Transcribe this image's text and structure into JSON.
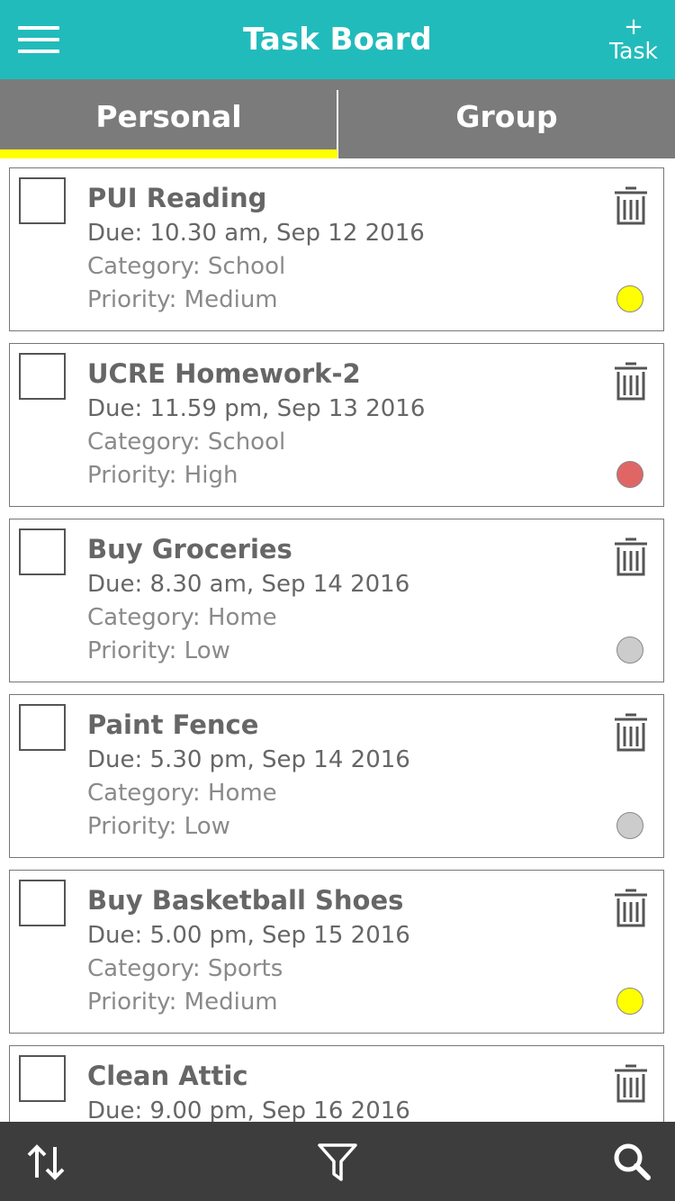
{
  "header": {
    "title": "Task Board",
    "add_plus": "+",
    "add_label": "Task",
    "color": "#22bbbb"
  },
  "tabs": [
    {
      "label": "Personal",
      "active": true
    },
    {
      "label": "Group",
      "active": false
    }
  ],
  "tab_indicator_color": "#ffff00",
  "tasks": [
    {
      "title": "PUI Reading",
      "due": "Due: 10.30 am, Sep 12 2016",
      "category": "Category: School",
      "priority": "Priority: Medium",
      "priority_color": "#ffff00"
    },
    {
      "title": "UCRE Homework-2",
      "due": "Due: 11.59 pm, Sep 13 2016",
      "category": "Category: School",
      "priority": "Priority: High",
      "priority_color": "#e06666"
    },
    {
      "title": "Buy Groceries",
      "due": "Due: 8.30 am, Sep 14 2016",
      "category": "Category: Home",
      "priority": "Priority: Low",
      "priority_color": "#cccccc"
    },
    {
      "title": "Paint Fence",
      "due": "Due: 5.30 pm, Sep 14 2016",
      "category": "Category: Home",
      "priority": "Priority: Low",
      "priority_color": "#cccccc"
    },
    {
      "title": "Buy Basketball Shoes",
      "due": "Due: 5.00 pm, Sep 15 2016",
      "category": "Category: Sports",
      "priority": "Priority: Medium",
      "priority_color": "#ffff00"
    },
    {
      "title": "Clean Attic",
      "due": "Due: 9.00 pm, Sep 16 2016",
      "category": "",
      "priority": "",
      "priority_color": ""
    }
  ],
  "bottom_bar": {
    "icons": [
      "sort-icon",
      "filter-icon",
      "search-icon"
    ]
  }
}
